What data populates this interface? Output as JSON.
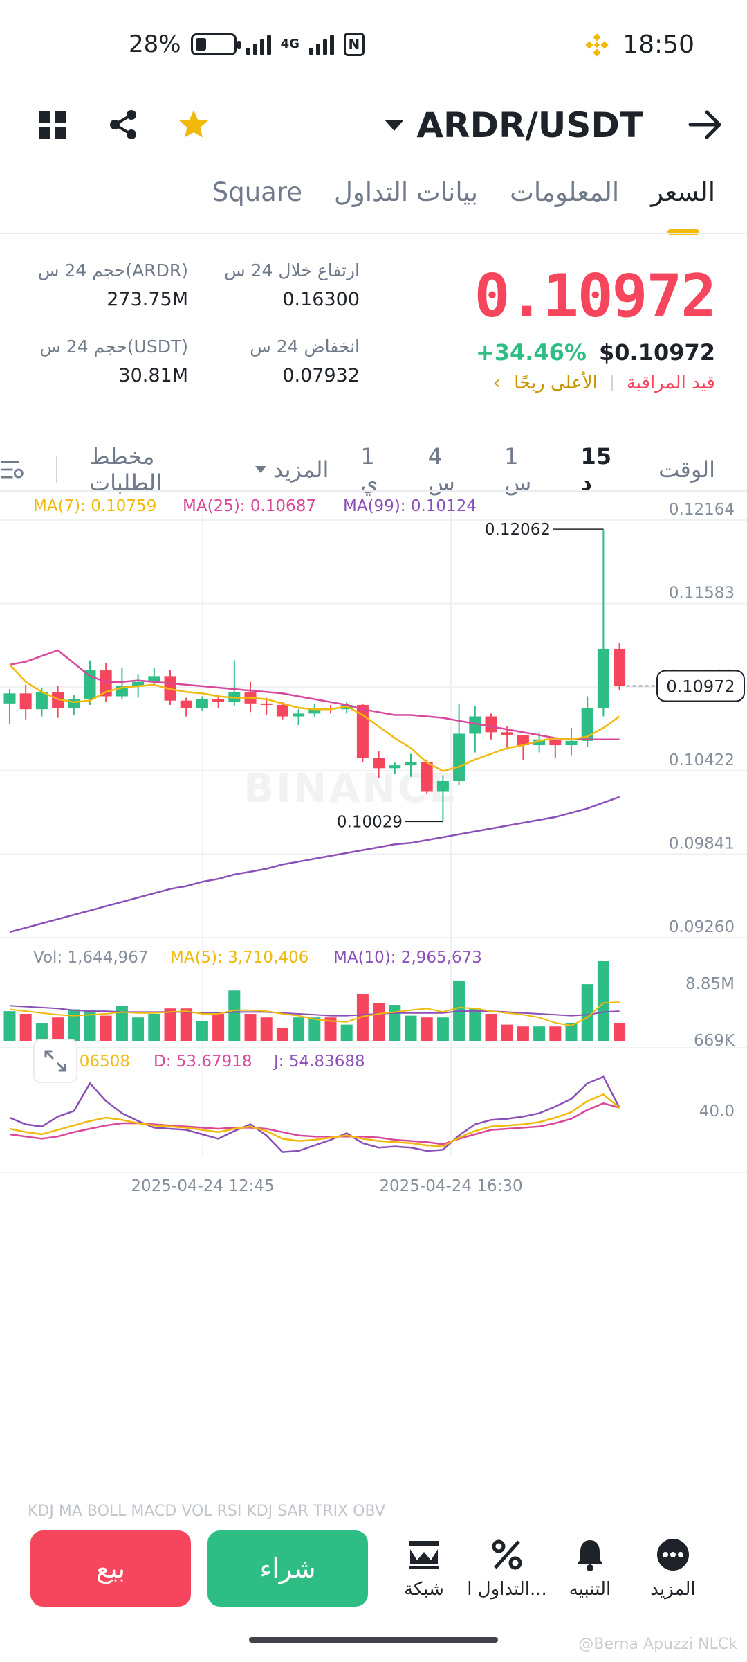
{
  "status_bar": {
    "battery": "28%",
    "battery_level": 0.28,
    "network": "4G",
    "time": "18:50"
  },
  "header": {
    "pair": "ARDR/USDT",
    "icons": [
      "grid-icon",
      "share-icon",
      "star-icon",
      "back-arrow-icon"
    ]
  },
  "tabs": [
    {
      "label": "السعر",
      "active": true
    },
    {
      "label": "المعلومات",
      "active": false
    },
    {
      "label": "بيانات التداول",
      "active": false
    },
    {
      "label": "Square",
      "active": false
    }
  ],
  "price": {
    "last": "0.10972",
    "usd": "$0.10972",
    "change": "+34.46%",
    "tag_watch": "قيد المراقبة",
    "tag_top": "الأعلى ربحًا"
  },
  "stats": {
    "high_label": "ارتفاع خلال 24 س",
    "high_value": "0.16300",
    "low_label": "انخفاض 24 س",
    "low_value": "0.07932",
    "vol_base_label": "حجم 24 س(ARDR)",
    "vol_base_value": "273.75M",
    "vol_quote_label": "حجم 24 س(USDT)",
    "vol_quote_value": "30.81M"
  },
  "intervals": {
    "time_label": "الوقت",
    "options": [
      "15 د",
      "1 س",
      "4 س",
      "1 ي"
    ],
    "selected": "15 د",
    "more": "المزيد",
    "depth": "مخطط الطلبات"
  },
  "chart_data": {
    "type": "candlestick",
    "watermark": "BINANCE",
    "ma_legend": {
      "ma7": "MA(7): 0.10759",
      "ma25": "MA(25): 0.10687",
      "ma99": "MA(99): 0.10124"
    },
    "price_axis": [
      "0.12164",
      "0.11583",
      "0.11003",
      "0.10422",
      "0.09841",
      "0.09260"
    ],
    "ylim": [
      0.0926,
      0.12164
    ],
    "current_price_label": "0.10972",
    "high_label": "0.12062",
    "low_label": "0.10029",
    "time_axis": [
      "2025-04-24 12:45",
      "2025-04-24 16:30"
    ],
    "candles": [
      [
        0.1085,
        0.1092,
        0.1071,
        0.1095
      ],
      [
        0.1092,
        0.1081,
        0.1074,
        0.1098
      ],
      [
        0.1081,
        0.1093,
        0.1076,
        0.1096
      ],
      [
        0.1093,
        0.1082,
        0.1075,
        0.1097
      ],
      [
        0.1082,
        0.1088,
        0.1077,
        0.1091
      ],
      [
        0.1088,
        0.1108,
        0.1084,
        0.1115
      ],
      [
        0.1108,
        0.109,
        0.1086,
        0.1113
      ],
      [
        0.109,
        0.1097,
        0.1088,
        0.111
      ],
      [
        0.1097,
        0.11,
        0.1089,
        0.1105
      ],
      [
        0.11,
        0.1104,
        0.1097,
        0.111
      ],
      [
        0.1104,
        0.1087,
        0.1084,
        0.1108
      ],
      [
        0.1087,
        0.1082,
        0.1076,
        0.1089
      ],
      [
        0.1082,
        0.1088,
        0.108,
        0.109
      ],
      [
        0.1088,
        0.1086,
        0.1082,
        0.1091
      ],
      [
        0.1086,
        0.1093,
        0.1083,
        0.1115
      ],
      [
        0.1093,
        0.1085,
        0.1079,
        0.11
      ],
      [
        0.1085,
        0.1084,
        0.1077,
        0.1089
      ],
      [
        0.1084,
        0.1076,
        0.1074,
        0.1086
      ],
      [
        0.1076,
        0.1078,
        0.107,
        0.1081
      ],
      [
        0.1078,
        0.1082,
        0.1076,
        0.1085
      ],
      [
        0.1082,
        0.1081,
        0.1078,
        0.1084
      ],
      [
        0.1081,
        0.1084,
        0.1078,
        0.1086
      ],
      [
        0.1084,
        0.1047,
        0.1044,
        0.1085
      ],
      [
        0.1047,
        0.104,
        0.1033,
        0.1052
      ],
      [
        0.104,
        0.1042,
        0.1036,
        0.1044
      ],
      [
        0.1042,
        0.1044,
        0.1034,
        0.105
      ],
      [
        0.1044,
        0.1024,
        0.1022,
        0.1046
      ],
      [
        0.1024,
        0.1031,
        0.1003,
        0.1035
      ],
      [
        0.1031,
        0.1064,
        0.1028,
        0.1085
      ],
      [
        0.1064,
        0.1076,
        0.1051,
        0.1083
      ],
      [
        0.1076,
        0.1065,
        0.106,
        0.1078
      ],
      [
        0.1065,
        0.1063,
        0.1053,
        0.1069
      ],
      [
        0.1063,
        0.1056,
        0.1046,
        0.1063
      ],
      [
        0.1056,
        0.106,
        0.1051,
        0.1065
      ],
      [
        0.106,
        0.1056,
        0.1047,
        0.1061
      ],
      [
        0.1056,
        0.1059,
        0.1049,
        0.1068
      ],
      [
        0.1059,
        0.1082,
        0.1055,
        0.109
      ],
      [
        0.1082,
        0.1123,
        0.1076,
        0.1206
      ],
      [
        0.1123,
        0.1097,
        0.1094,
        0.1127
      ]
    ],
    "ma7": [
      0.1112,
      0.11,
      0.1093,
      0.1088,
      0.1086,
      0.1087,
      0.1093,
      0.1096,
      0.1097,
      0.1098,
      0.1095,
      0.1093,
      0.1092,
      0.109,
      0.1089,
      0.1089,
      0.1088,
      0.1085,
      0.1082,
      0.1081,
      0.1081,
      0.1083,
      0.1077,
      0.1069,
      0.1061,
      0.1054,
      0.1044,
      0.1038,
      0.1041,
      0.1046,
      0.105,
      0.1054,
      0.1056,
      0.1059,
      0.1061,
      0.106,
      0.1062,
      0.1068,
      0.1076
    ],
    "ma25": [
      0.1112,
      0.1114,
      0.1118,
      0.1122,
      0.1113,
      0.1104,
      0.11,
      0.11,
      0.1101,
      0.11,
      0.1099,
      0.1098,
      0.1097,
      0.1096,
      0.1095,
      0.1094,
      0.1093,
      0.1092,
      0.109,
      0.1088,
      0.1086,
      0.1084,
      0.1081,
      0.1079,
      0.1077,
      0.1077,
      0.1076,
      0.1075,
      0.1073,
      0.1071,
      0.1069,
      0.1067,
      0.1065,
      0.1063,
      0.1061,
      0.106,
      0.106,
      0.106,
      0.106
    ],
    "ma99": [
      0.0926,
      0.0929,
      0.0932,
      0.0935,
      0.0938,
      0.0941,
      0.0944,
      0.0947,
      0.095,
      0.0953,
      0.0956,
      0.0958,
      0.0961,
      0.0963,
      0.0966,
      0.0968,
      0.097,
      0.0973,
      0.0975,
      0.0977,
      0.0979,
      0.0981,
      0.0983,
      0.0985,
      0.0987,
      0.0988,
      0.099,
      0.0992,
      0.0994,
      0.0996,
      0.0998,
      0.1,
      0.1002,
      0.1004,
      0.1006,
      0.1009,
      0.1012,
      0.1016,
      0.102
    ],
    "volume": {
      "legend": {
        "vol": "Vol: 1,644,967",
        "ma5": "MA(5): 3,710,406",
        "ma10": "MA(10): 2,965,673"
      },
      "axis": [
        "8.85M",
        "669K"
      ],
      "ylim": [
        0,
        8.85
      ],
      "values": [
        3.3,
        3.0,
        2.0,
        2.6,
        3.5,
        3.4,
        2.8,
        3.9,
        2.6,
        3.0,
        3.6,
        3.6,
        2.2,
        3.0,
        5.6,
        3.0,
        2.6,
        1.4,
        2.6,
        2.6,
        2.6,
        1.8,
        5.2,
        4.2,
        4.0,
        2.8,
        2.6,
        2.6,
        6.7,
        3.6,
        3.0,
        1.8,
        1.6,
        1.6,
        1.6,
        2.0,
        6.3,
        8.85,
        2.0
      ],
      "ma5": [
        3.5,
        3.3,
        3.1,
        2.9,
        2.8,
        2.9,
        3.0,
        3.2,
        3.1,
        3.1,
        3.2,
        3.3,
        3.0,
        3.0,
        3.4,
        3.4,
        3.3,
        3.0,
        2.8,
        2.4,
        2.2,
        2.1,
        2.7,
        3.0,
        3.2,
        3.4,
        3.6,
        3.2,
        3.7,
        3.6,
        3.3,
        3.1,
        2.9,
        2.6,
        2.0,
        1.7,
        2.6,
        4.2,
        4.3
      ],
      "ma10": [
        3.9,
        3.8,
        3.7,
        3.6,
        3.4,
        3.3,
        3.3,
        3.2,
        3.2,
        3.2,
        3.2,
        3.2,
        3.1,
        3.1,
        3.2,
        3.2,
        3.2,
        3.1,
        3.0,
        2.9,
        2.8,
        2.8,
        2.9,
        3.0,
        3.1,
        3.1,
        3.1,
        3.1,
        3.3,
        3.3,
        3.3,
        3.2,
        3.1,
        3.0,
        2.9,
        2.8,
        2.9,
        3.2,
        3.3
      ]
    },
    "kdj": {
      "legend": {
        "k": "K: 54.06508",
        "d": "D: 53.67918",
        "j": "J: 54.83688"
      },
      "axis": [
        "40.0"
      ],
      "ylim": [
        0,
        100
      ],
      "k": [
        45,
        42,
        40,
        44,
        48,
        52,
        55,
        53,
        50,
        48,
        47,
        46,
        44,
        42,
        45,
        47,
        43,
        36,
        34,
        35,
        37,
        39,
        36,
        34,
        33,
        32,
        30,
        29,
        37,
        43,
        47,
        48,
        49,
        51,
        55,
        60,
        70,
        76,
        64
      ],
      "d": [
        40,
        38,
        36,
        38,
        42,
        45,
        48,
        50,
        50,
        49,
        48,
        47,
        46,
        45,
        46,
        46,
        45,
        42,
        39,
        38,
        38,
        38,
        38,
        37,
        35,
        34,
        33,
        31,
        36,
        40,
        44,
        45,
        46,
        47,
        50,
        54,
        62,
        68,
        64
      ],
      "j": [
        55,
        49,
        47,
        56,
        61,
        86,
        70,
        59,
        52,
        46,
        45,
        44,
        40,
        36,
        43,
        49,
        39,
        24,
        25,
        30,
        35,
        41,
        32,
        28,
        29,
        28,
        25,
        26,
        39,
        49,
        53,
        54,
        56,
        59,
        65,
        72,
        86,
        92,
        64
      ],
      "k_color": "#f0b90b",
      "d_color": "#d9479a",
      "j_color": "#8a4fb8"
    },
    "colors": {
      "up": "#2ebd85",
      "down": "#f6465d",
      "ma7": "#f0b90b",
      "ma25": "#d9479a",
      "ma99": "#8a4fb8"
    }
  },
  "indicator_strip": "KDJ  MA  BOLL  MACD  VOL  RSI  KDJ  SAR  TRIX  OBV",
  "bottom_bar": {
    "sell": "بيع",
    "buy": "شراء",
    "grid": "شبكة",
    "margin": "التداول ا...",
    "alert": "التنبيه",
    "more": "المزيد"
  },
  "credit": "@Berna Apuzzi NLCk",
  "colors": {
    "accent": "#f0b90b",
    "up": "#2ebd85",
    "down": "#f6465d",
    "text_primary": "#1e2329",
    "text_secondary": "#707a8a"
  }
}
